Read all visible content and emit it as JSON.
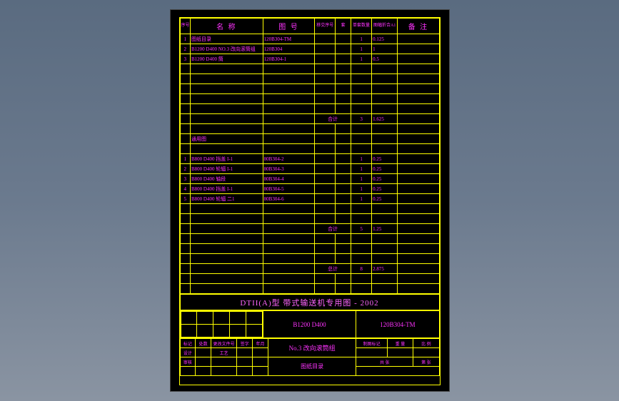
{
  "header": {
    "c_idx": "序号",
    "c_name": "名 称",
    "c_no": "图 号",
    "c_a": "移交序号",
    "c_b": "套",
    "c_c": "单套数量",
    "c_d": "图幅折合A1",
    "c_e": "备 注"
  },
  "rows_top": [
    {
      "idx": "1",
      "name": "图纸目录",
      "no": "120B304-TM",
      "a": "",
      "b": "",
      "c": "1",
      "d": "0.125",
      "e": ""
    },
    {
      "idx": "2",
      "name": "B1200 D400 NO.3 改向滚筒组",
      "no": "120B304",
      "a": "",
      "b": "",
      "c": "1",
      "d": "1",
      "e": ""
    },
    {
      "idx": "3",
      "name": "B1200 D400 筒",
      "no": "120B304-1",
      "a": "",
      "b": "",
      "c": "1",
      "d": "0.5",
      "e": ""
    }
  ],
  "subtotal1": {
    "lbl": "合计",
    "c": "3",
    "d": "1.625"
  },
  "common_hdr": "通用图",
  "rows_bot": [
    {
      "idx": "1",
      "name": "B800 D400 挡盖 I-1",
      "no": "80B304-2",
      "a": "",
      "b": "",
      "c": "1",
      "d": "0.25",
      "e": ""
    },
    {
      "idx": "2",
      "name": "B800 D400 轮辐 I-1",
      "no": "80B304-3",
      "a": "",
      "b": "",
      "c": "1",
      "d": "0.25",
      "e": ""
    },
    {
      "idx": "3",
      "name": "B800 D400 轴段",
      "no": "80B304-4",
      "a": "",
      "b": "",
      "c": "1",
      "d": "0.25",
      "e": ""
    },
    {
      "idx": "4",
      "name": "B800 D400 挡盖 I-1",
      "no": "80B304-5",
      "a": "",
      "b": "",
      "c": "1",
      "d": "0.25",
      "e": ""
    },
    {
      "idx": "5",
      "name": "B800 D400 轮辐 二1",
      "no": "80B304-6",
      "a": "",
      "b": "",
      "c": "1",
      "d": "0.25",
      "e": ""
    }
  ],
  "subtotal2": {
    "lbl": "合计",
    "c": "5",
    "d": "1.25"
  },
  "grandtotal": {
    "lbl": "总计",
    "c": "8",
    "d": "2.875"
  },
  "title_band": "DTII(A)型  带式输送机专用图 - 2002",
  "tb2": {
    "left": "B1200  D400",
    "right": "120B304-TM"
  },
  "tb3": {
    "r1": [
      "标记",
      "处数",
      "更改文件号",
      "签字",
      "年月",
      "",
      "",
      "",
      "制图标记",
      "重 量",
      "比 例"
    ],
    "mid": "No.3 改向滚筒组",
    "r2": [
      "设计",
      "",
      "工艺",
      "",
      "",
      ""
    ],
    "r3": [
      "审核",
      "",
      "",
      "",
      "",
      "共  张",
      "第  张"
    ],
    "bottom": "图纸目录"
  }
}
